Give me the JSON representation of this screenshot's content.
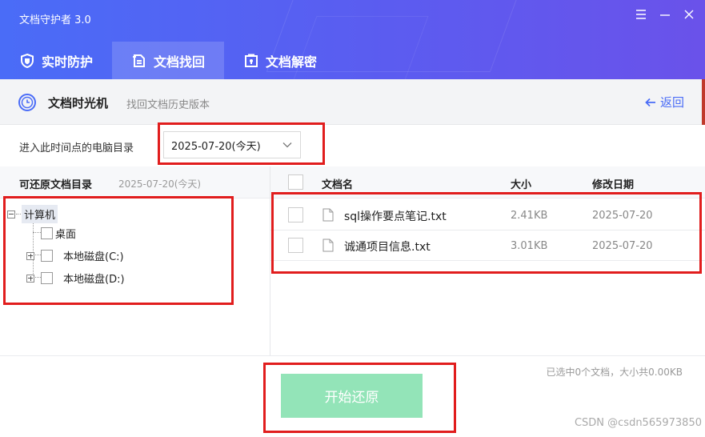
{
  "app": {
    "title": "文档守护者 3.0"
  },
  "tabs": [
    {
      "label": "实时防护",
      "icon": "shield-icon",
      "active": false
    },
    {
      "label": "文档找回",
      "icon": "document-recover-icon",
      "active": true
    },
    {
      "label": "文档解密",
      "icon": "unlock-icon",
      "active": false
    }
  ],
  "subheader": {
    "title": "文档时光机",
    "description": "找回文档历史版本",
    "back_label": "返回"
  },
  "timepoint": {
    "label": "进入此时间点的电脑目录",
    "selected": "2025-07-20(今天)"
  },
  "tree": {
    "header": "可还原文档目录",
    "header_date": "2025-07-20(今天)",
    "root": "计算机",
    "nodes": [
      "桌面",
      "本地磁盘(C:)",
      "本地磁盘(D:)"
    ]
  },
  "file_table": {
    "columns": {
      "name": "文档名",
      "size": "大小",
      "date": "修改日期"
    },
    "rows": [
      {
        "name": "sql操作要点笔记.txt",
        "size": "2.41KB",
        "date": "2025-07-20"
      },
      {
        "name": "诚通项目信息.txt",
        "size": "3.01KB",
        "date": "2025-07-20"
      }
    ]
  },
  "footer": {
    "selection_info": "已选中0个文档，大小共0.00KB",
    "restore_label": "开始还原"
  },
  "watermark": "CSDN @csdn565973850",
  "colors": {
    "header_start": "#4a6cf7",
    "header_end": "#6a52ea",
    "accent": "#4a6cf7",
    "restore_button": "#93e4b8",
    "annotation_red": "#e11d1d"
  }
}
